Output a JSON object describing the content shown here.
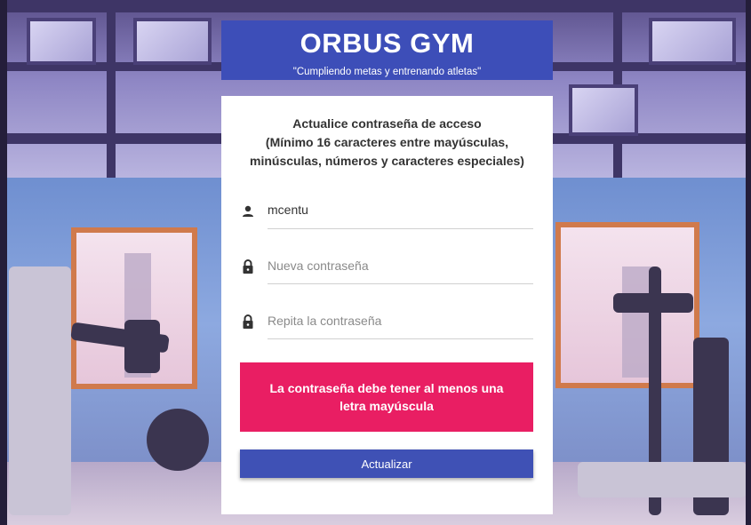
{
  "header": {
    "title": "ORBUS GYM",
    "tagline": "\"Cumpliendo metas y entrenando atletas\""
  },
  "form": {
    "instructions": [
      "Actualice contraseña de acceso",
      "(Mínimo 16 caracteres entre mayúsculas,",
      "minúsculas, números y caracteres especiales)"
    ],
    "username": {
      "value": "mcentu",
      "icon": "person-icon"
    },
    "new_password": {
      "placeholder": "Nueva contraseña",
      "icon": "lock-icon"
    },
    "repeat_password": {
      "placeholder": "Repita la contraseña",
      "icon": "lock-icon"
    },
    "error_message": "La contraseña debe tener al menos una letra mayúscula",
    "submit_label": "Actualizar"
  },
  "colors": {
    "brand": "#3d4eb8",
    "button": "#3f51b5",
    "error": "#e91e63"
  }
}
